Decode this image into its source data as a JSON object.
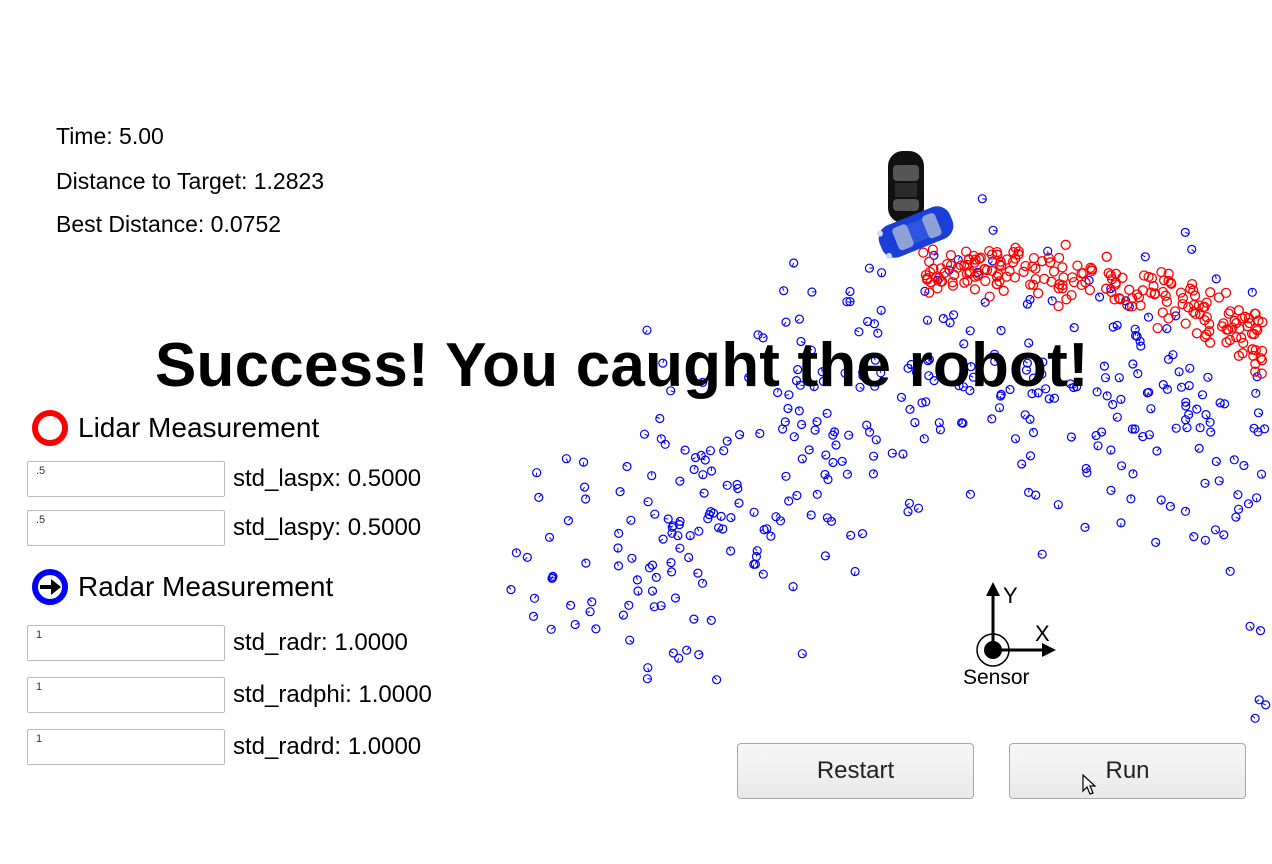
{
  "stats": {
    "time": "Time: 5.00",
    "distance": "Distance to Target: 1.2823",
    "best": "Best Distance: 0.0752"
  },
  "banner": "Success! You caught the robot!",
  "legend": {
    "lidar": "Lidar Measurement",
    "radar": "Radar Measurement"
  },
  "params": [
    {
      "value": ".5",
      "label": "std_laspx: 0.5000"
    },
    {
      "value": ".5",
      "label": "std_laspy: 0.5000"
    },
    {
      "value": "1",
      "label": "std_radr: 1.0000"
    },
    {
      "value": "1",
      "label": "std_radphi: 1.0000"
    },
    {
      "value": "1",
      "label": "std_radrd: 1.0000"
    }
  ],
  "axes": {
    "x": "X",
    "y": "Y",
    "origin": "Sensor"
  },
  "buttons": {
    "restart": "Restart",
    "run": "Run"
  },
  "colors": {
    "lidar": "#ff0000",
    "radar": "#0000ff",
    "hunter_car": "#1a3fd6",
    "target_car": "#111111"
  },
  "icons": [
    "hunter-car-icon",
    "target-car-icon",
    "mouse-cursor-icon",
    "radar-arrow-icon"
  ]
}
